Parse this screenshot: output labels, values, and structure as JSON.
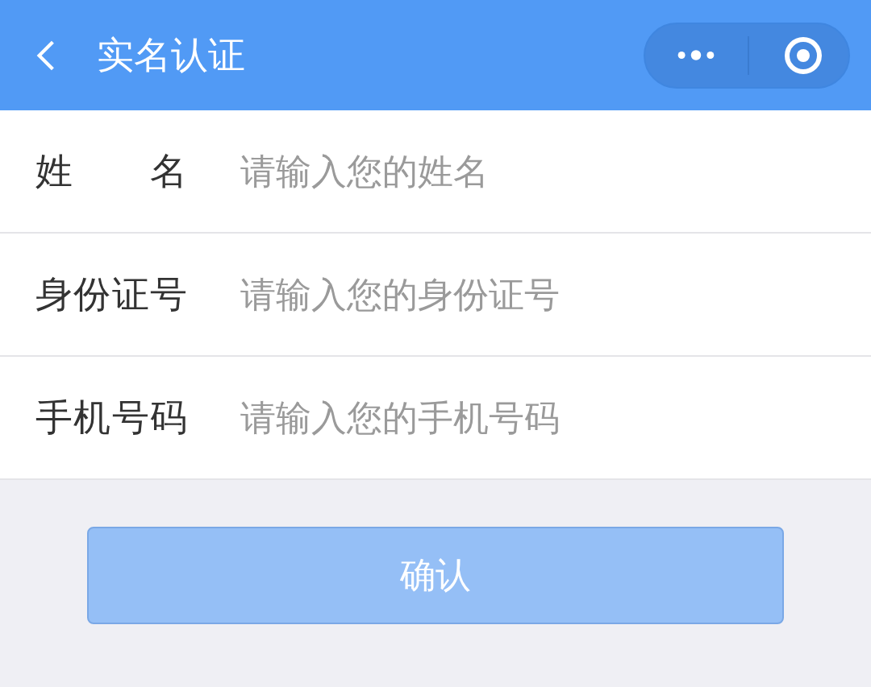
{
  "nav_bar": {
    "title": "实名认证"
  },
  "form": {
    "fields": [
      {
        "label": "姓名",
        "placeholder": "请输入您的姓名"
      },
      {
        "label": "身份证号",
        "placeholder": "请输入您的身份证号"
      },
      {
        "label": "手机号码",
        "placeholder": "请输入您的手机号码"
      }
    ]
  },
  "confirm_button": {
    "label": "确认",
    "disabled": true
  }
}
